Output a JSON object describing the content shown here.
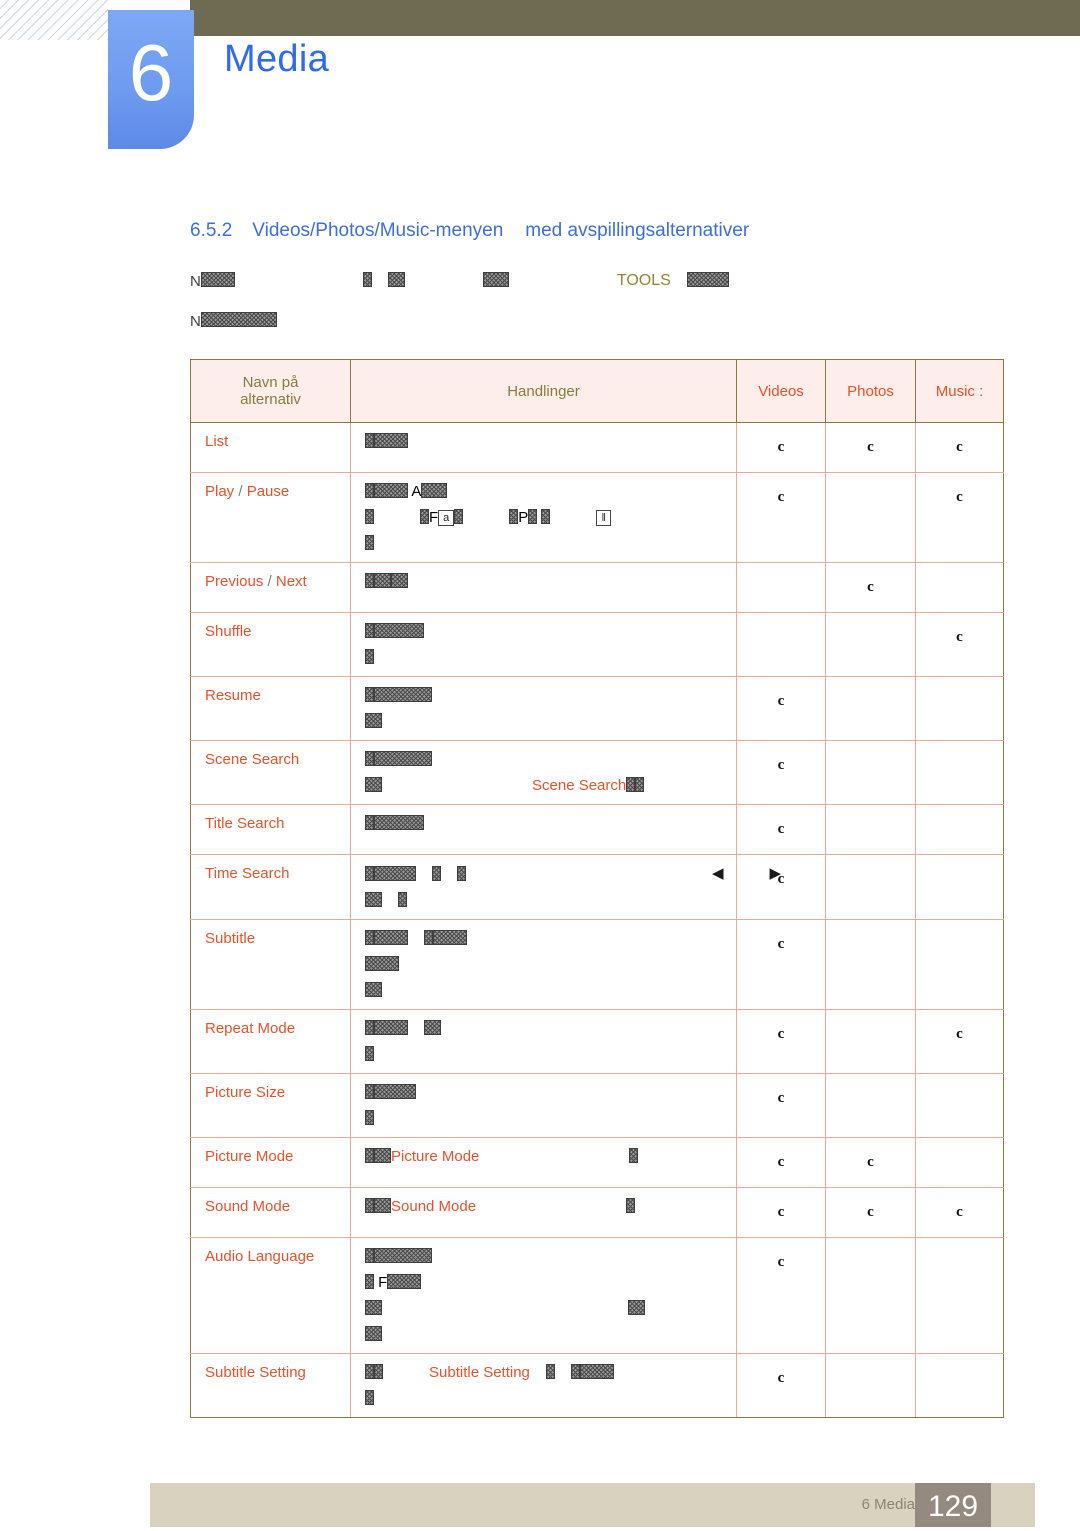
{
  "header": {
    "chapter_number": "6",
    "chapter_title": "Media",
    "badge_color": "#6f9bf0",
    "title_color": "#2f6bed",
    "bar_color": "#6e6b52"
  },
  "section": {
    "number": "6.5.2",
    "title_part1": "Videos/Photos/Music-menyen",
    "title_part2": "med avspillingsalternativer",
    "color": "#3b6fe0"
  },
  "intro": {
    "line1_prefix": "N",
    "tools_keyword": "TOOLS",
    "line2_prefix": "N"
  },
  "table": {
    "headers": {
      "name": "Navn på alternativ",
      "name_line1": "Navn på",
      "name_line2": "alternativ",
      "actions": "Handlinger",
      "videos": "Videos",
      "photos": "Photos",
      "music": "Music :"
    },
    "header_colors": {
      "olive": "#8a7b3a",
      "red": "#e8522a",
      "background": "#fdeeec"
    },
    "mark_glyph": "c",
    "rows": [
      {
        "name": "List",
        "name_parts": [
          "List"
        ],
        "videos": true,
        "photos": true,
        "music": true
      },
      {
        "name": "Play / Pause",
        "name_parts": [
          "Play",
          "/",
          "Pause"
        ],
        "videos": true,
        "photos": false,
        "music": true
      },
      {
        "name": "Previous / Next",
        "name_parts": [
          "Previous",
          "/",
          "Next"
        ],
        "videos": false,
        "photos": true,
        "music": false
      },
      {
        "name": "Shuffle",
        "name_parts": [
          "Shuffle"
        ],
        "videos": false,
        "photos": false,
        "music": true
      },
      {
        "name": "Resume",
        "name_parts": [
          "Resume"
        ],
        "videos": true,
        "photos": false,
        "music": false
      },
      {
        "name": "Scene Search",
        "name_parts": [
          "Scene Search"
        ],
        "inline_keyword": "Scene Search",
        "videos": true,
        "photos": false,
        "music": false
      },
      {
        "name": "Title Search",
        "name_parts": [
          "Title Search"
        ],
        "videos": true,
        "photos": false,
        "music": false
      },
      {
        "name": "Time Search",
        "name_parts": [
          "Time Search"
        ],
        "videos": true,
        "photos": false,
        "music": false
      },
      {
        "name": "Subtitle",
        "name_parts": [
          "Subtitle"
        ],
        "videos": true,
        "photos": false,
        "music": false
      },
      {
        "name": "Repeat Mode",
        "name_parts": [
          "Repeat Mode"
        ],
        "videos": true,
        "photos": false,
        "music": true
      },
      {
        "name": "Picture Size",
        "name_parts": [
          "Picture Size"
        ],
        "videos": true,
        "photos": false,
        "music": false
      },
      {
        "name": "Picture Mode",
        "name_parts": [
          "Picture Mode"
        ],
        "inline_keyword": "Picture Mode",
        "videos": true,
        "photos": true,
        "music": false
      },
      {
        "name": "Sound Mode",
        "name_parts": [
          "Sound Mode"
        ],
        "inline_keyword": "Sound Mode",
        "videos": true,
        "photos": true,
        "music": true
      },
      {
        "name": "Audio Language",
        "name_parts": [
          "Audio Language"
        ],
        "videos": true,
        "photos": false,
        "music": false
      },
      {
        "name": "Subtitle Setting",
        "name_parts": [
          "Subtitle Setting"
        ],
        "inline_keyword": "Subtitle Setting",
        "videos": true,
        "photos": false,
        "music": false
      }
    ]
  },
  "footer": {
    "label": "6 Media",
    "page_number": "129",
    "bar_color": "#d9d2bf",
    "page_box_color": "#948a80"
  }
}
